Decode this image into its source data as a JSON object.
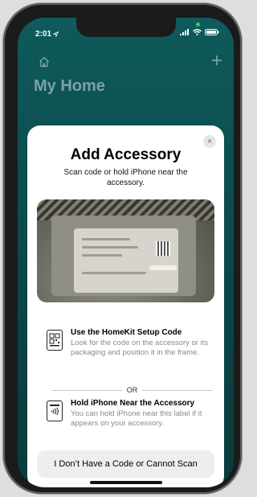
{
  "status_bar": {
    "time": "2:01"
  },
  "home": {
    "title": "My Home",
    "add_symbol": "+"
  },
  "sheet": {
    "close_symbol": "×",
    "title": "Add Accessory",
    "subtitle": "Scan code or hold iPhone near the accessory.",
    "option_setup_code": {
      "title": "Use the HomeKit Setup Code",
      "description": "Look for the code on the accessory or its packaging and position it in the frame."
    },
    "divider_text": "OR",
    "option_nfc": {
      "title": "Hold iPhone Near the Accessory",
      "description": "You can hold iPhone near this label if it appears on your accessory."
    },
    "no_code_button": "I Don’t Have a Code or Cannot Scan"
  },
  "icons": {
    "home": "house-icon",
    "add": "plus-icon",
    "close": "close-icon",
    "setup_code": "qr-code-icon",
    "nfc": "nfc-tag-icon",
    "signal": "cellular-signal-icon",
    "wifi": "wifi-icon",
    "battery": "battery-icon",
    "location": "location-arrow-icon"
  },
  "colors": {
    "background_teal": "#0f5a5c",
    "sheet_bg": "#ffffff",
    "button_bg": "#eeeef0",
    "secondary_text": "#8a8a8e"
  }
}
